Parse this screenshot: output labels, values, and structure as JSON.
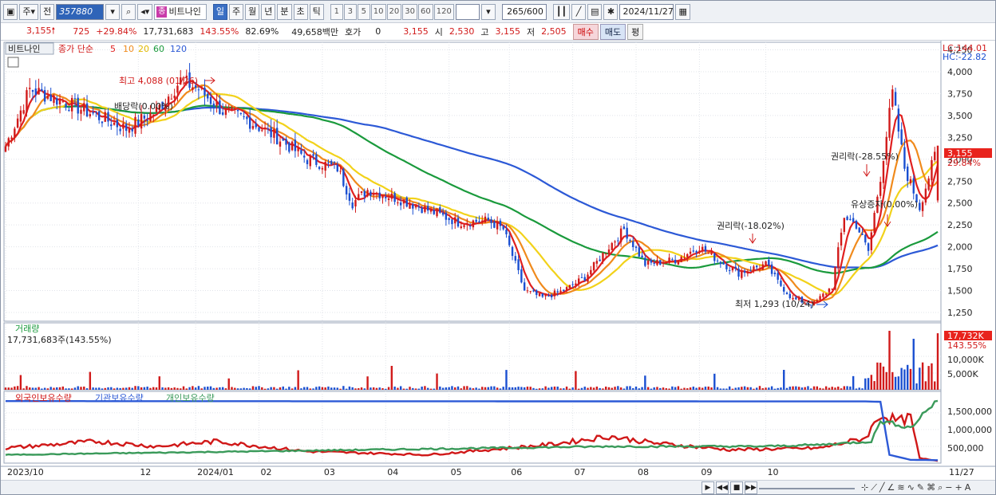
{
  "toolbar": {
    "period_mode": "주",
    "prev_label": "전",
    "code": "357880",
    "jong_badge": "종",
    "stock_name": "비트나인",
    "intervals": [
      {
        "label": "일",
        "active": true
      },
      {
        "label": "주",
        "active": false
      },
      {
        "label": "월",
        "active": false
      },
      {
        "label": "년",
        "active": false
      },
      {
        "label": "분",
        "active": false
      },
      {
        "label": "초",
        "active": false
      },
      {
        "label": "틱",
        "active": false
      }
    ],
    "minute_options": [
      "1",
      "3",
      "5",
      "10",
      "20",
      "30",
      "60",
      "120"
    ],
    "count_value": "265",
    "count_max": "/600",
    "date_value": "2024/11/27"
  },
  "quote": {
    "price": "3,155",
    "change": "725",
    "change_pct": "+29.84%",
    "volume": "17,731,683",
    "volume_ratio": "143.55%",
    "turnover": "82.69%",
    "amount": "49,658백만",
    "hoga_label": "호가",
    "hoga_value": "0",
    "hoga_price": "3,155",
    "open_label": "시",
    "open": "2,530",
    "high_label": "고",
    "high": "3,155",
    "low_label": "저",
    "low": "2,505",
    "buy_label": "매수",
    "sell_label": "매도",
    "avg_label": "평"
  },
  "legend": {
    "name": "비트나인",
    "indicator": "종가 단순",
    "ma": [
      {
        "label": "5",
        "color": "#e02020"
      },
      {
        "label": "10",
        "color": "#f08a1c"
      },
      {
        "label": "20",
        "color": "#f2d21a"
      },
      {
        "label": "60",
        "color": "#1a9a3c"
      },
      {
        "label": "120",
        "color": "#2c59d6"
      }
    ]
  },
  "annotations": {
    "high": "최고 4,088 (01/26)",
    "dividend": "배당락(0.00%)",
    "rights1": "권리락(-18.02%)",
    "low": "최저 1,293 (10/24)",
    "rights2": "권리락(-28.55%)",
    "paid_increase": "유상증자(0.00%)"
  },
  "price_axis": {
    "lc": "LC:144.01",
    "hc": "HC:-22.82",
    "ticks": [
      "4,250",
      "4,000",
      "3,750",
      "3,500",
      "3,250",
      "3,000",
      "2,750",
      "2,500",
      "2,250",
      "2,000",
      "1,750",
      "1,500",
      "1,250"
    ],
    "current_price": "3,155",
    "current_pct": "29.84%"
  },
  "volume_panel": {
    "title": "거래량",
    "value": "17,731,683주(143.55%)",
    "ticks": [
      "10,000K",
      "5,000K"
    ],
    "current": "17,732K",
    "current_pct": "143.55%"
  },
  "holdings_panel": {
    "series": [
      {
        "label": "외국인보유수량",
        "color": "#d01818"
      },
      {
        "label": "기관보유수량",
        "color": "#2c59d6"
      },
      {
        "label": "개인보유수량",
        "color": "#3a9a5a"
      }
    ],
    "ticks": [
      "1,500,000",
      "1,000,000",
      "500,000"
    ]
  },
  "x_axis": {
    "labels": [
      "2023/10",
      "12",
      "2024/01",
      "02",
      "03",
      "04",
      "05",
      "06",
      "07",
      "08",
      "09",
      "10",
      "11"
    ],
    "end_label": "11/27"
  },
  "colors": {
    "up": "#d11a1a",
    "down": "#1a4fd1",
    "grid": "#d9dde4",
    "axis_bg": "#ffffff",
    "highlight_red": "#e8231d"
  },
  "chart_data": {
    "type": "candlestick",
    "price_ticks": [
      4250,
      4000,
      3750,
      3500,
      3250,
      3000,
      2750,
      2500,
      2250,
      2000,
      1750,
      1500,
      1250
    ],
    "ylim": [
      1150,
      4300
    ],
    "month_starts": [
      0,
      44,
      63,
      84,
      105,
      126,
      147,
      167,
      188,
      209,
      230,
      252
    ],
    "price_keyframes": [
      [
        0,
        3150
      ],
      [
        8,
        3800
      ],
      [
        20,
        3650
      ],
      [
        30,
        3500
      ],
      [
        40,
        3350
      ],
      [
        50,
        3550
      ],
      [
        58,
        3900
      ],
      [
        64,
        3800
      ],
      [
        72,
        3550
      ],
      [
        80,
        3450
      ],
      [
        90,
        3250
      ],
      [
        100,
        3000
      ],
      [
        110,
        2900
      ],
      [
        115,
        2500
      ],
      [
        120,
        2650
      ],
      [
        130,
        2550
      ],
      [
        140,
        2420
      ],
      [
        150,
        2280
      ],
      [
        160,
        2300
      ],
      [
        165,
        2200
      ],
      [
        172,
        1500
      ],
      [
        178,
        1420
      ],
      [
        185,
        1500
      ],
      [
        192,
        1650
      ],
      [
        200,
        2000
      ],
      [
        205,
        2200
      ],
      [
        212,
        1800
      ],
      [
        222,
        1850
      ],
      [
        230,
        2000
      ],
      [
        236,
        1850
      ],
      [
        243,
        1700
      ],
      [
        252,
        1800
      ],
      [
        256,
        1600
      ],
      [
        261,
        1400
      ],
      [
        268,
        1350
      ],
      [
        274,
        1550
      ],
      [
        278,
        2350
      ],
      [
        282,
        2250
      ],
      [
        286,
        1950
      ],
      [
        290,
        2800
      ],
      [
        294,
        3750
      ],
      [
        298,
        2900
      ],
      [
        303,
        2450
      ],
      [
        309,
        3155
      ]
    ],
    "volume_ticks": [
      10000,
      5000
    ],
    "volume_max": 20000,
    "holdings_ticks": [
      1500000,
      1000000,
      500000
    ],
    "holdings_max": 1900000,
    "foreign_keyframes": [
      [
        0,
        400000
      ],
      [
        30,
        600000
      ],
      [
        50,
        450000
      ],
      [
        70,
        600000
      ],
      [
        100,
        300000
      ],
      [
        140,
        200000
      ],
      [
        180,
        500000
      ],
      [
        200,
        750000
      ],
      [
        215,
        550000
      ],
      [
        240,
        350000
      ],
      [
        270,
        400000
      ],
      [
        285,
        700000
      ],
      [
        290,
        1400000
      ],
      [
        296,
        1200000
      ],
      [
        300,
        1300000
      ],
      [
        303,
        100000
      ],
      [
        309,
        20000
      ]
    ],
    "institution_keyframes": [
      [
        0,
        1800000
      ],
      [
        285,
        1790000
      ],
      [
        290,
        1780000
      ],
      [
        293,
        200000
      ],
      [
        300,
        50000
      ],
      [
        309,
        40000
      ]
    ],
    "individual_keyframes": [
      [
        0,
        200000
      ],
      [
        80,
        300000
      ],
      [
        120,
        350000
      ],
      [
        160,
        400000
      ],
      [
        200,
        450000
      ],
      [
        250,
        450000
      ],
      [
        270,
        500000
      ],
      [
        287,
        600000
      ],
      [
        290,
        1200000
      ],
      [
        296,
        1100000
      ],
      [
        300,
        1000000
      ],
      [
        305,
        1500000
      ],
      [
        309,
        1850000
      ]
    ]
  }
}
